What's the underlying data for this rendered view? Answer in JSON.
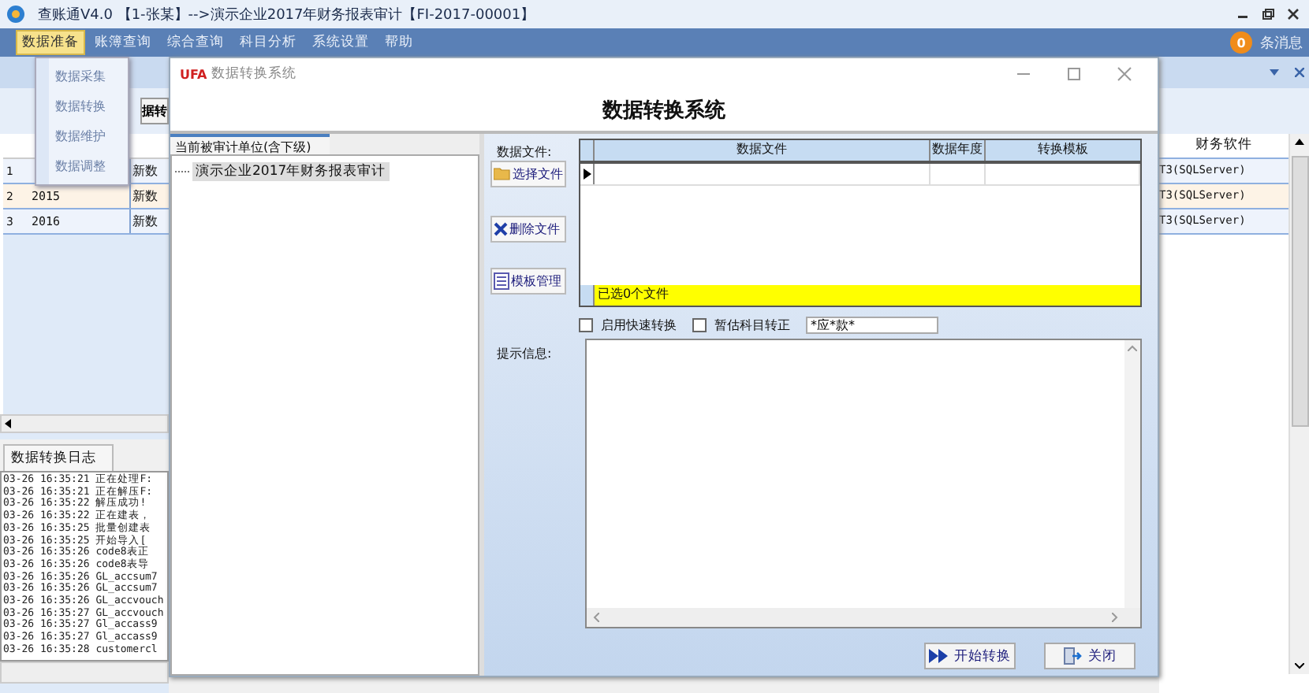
{
  "window": {
    "title": "查账通V4.0 【1-张某】-->演示企业2017年财务报表审计【FI-2017-00001】"
  },
  "menu": [
    {
      "label": "数据准备",
      "selected": true
    },
    {
      "label": "账簿查询",
      "selected": false
    },
    {
      "label": "综合查询",
      "selected": false
    },
    {
      "label": "科目分析",
      "selected": false
    },
    {
      "label": "系统设置",
      "selected": false
    },
    {
      "label": "帮助",
      "selected": false
    }
  ],
  "notifications": {
    "count": "0",
    "label": "条消息"
  },
  "dropdown": [
    {
      "label": "数据采集"
    },
    {
      "label": "数据转换"
    },
    {
      "label": "数据维护"
    },
    {
      "label": "数据调整"
    }
  ],
  "toolbar_button": "据转",
  "table": {
    "column_right": "财务软件",
    "rows": [
      {
        "index": "1",
        "column_3": "新数",
        "software": "T3(SQLServer)",
        "selected": false
      },
      {
        "index": "2",
        "year": "2015",
        "column_3": "新数",
        "software": "T3(SQLServer)",
        "selected": true
      },
      {
        "index": "3",
        "year": "2016",
        "column_3": "新数",
        "software": "T3(SQLServer)",
        "selected": false
      }
    ]
  },
  "log": {
    "tab": "数据转换日志",
    "lines": [
      "03-26 16:35:21 正在处理F:",
      "03-26 16:35:21 正在解压F:",
      "03-26 16:35:22 解压成功!",
      "03-26 16:35:22 正在建表，",
      "03-26 16:35:25 批量创建表",
      "03-26 16:35:25 开始导入[",
      "03-26 16:35:26 code8表正",
      "03-26 16:35:26 code8表导",
      "03-26 16:35:26 GL_accsum7",
      "03-26 16:35:26 GL_accsum7",
      "03-26 16:35:26 GL_accvouch",
      "03-26 16:35:27 GL_accvouch",
      "03-26 16:35:27 Gl_accass9",
      "03-26 16:35:27 Gl_accass9",
      "03-26 16:35:28 customercl"
    ]
  },
  "dialog": {
    "logo": "UFA",
    "title": "数据转换系统",
    "heading": "数据转换系统",
    "unit_tab": "当前被审计单位(含下级)",
    "tree": [
      {
        "label": "演示企业2017年财务报表审计",
        "selected": true
      }
    ],
    "files_label": "数据文件:",
    "buttons": [
      {
        "label": "选择文件",
        "kind": "folder"
      },
      {
        "label": "删除文件",
        "kind": "delete"
      },
      {
        "label": "模板管理",
        "kind": "list"
      }
    ],
    "grid": {
      "columns": [
        "数据文件",
        "数据年度",
        "转换模板"
      ],
      "footer": "已选0个文件"
    },
    "options": [
      {
        "label": "启用快速转换",
        "checked": false
      },
      {
        "label": "暂估科目转正",
        "checked": false
      }
    ],
    "filter": {
      "value": "*应*款*"
    },
    "info_label": "提示信息:",
    "actions": [
      {
        "label": "开始转换",
        "kind": "start"
      },
      {
        "label": "关闭",
        "kind": "close"
      }
    ]
  }
}
